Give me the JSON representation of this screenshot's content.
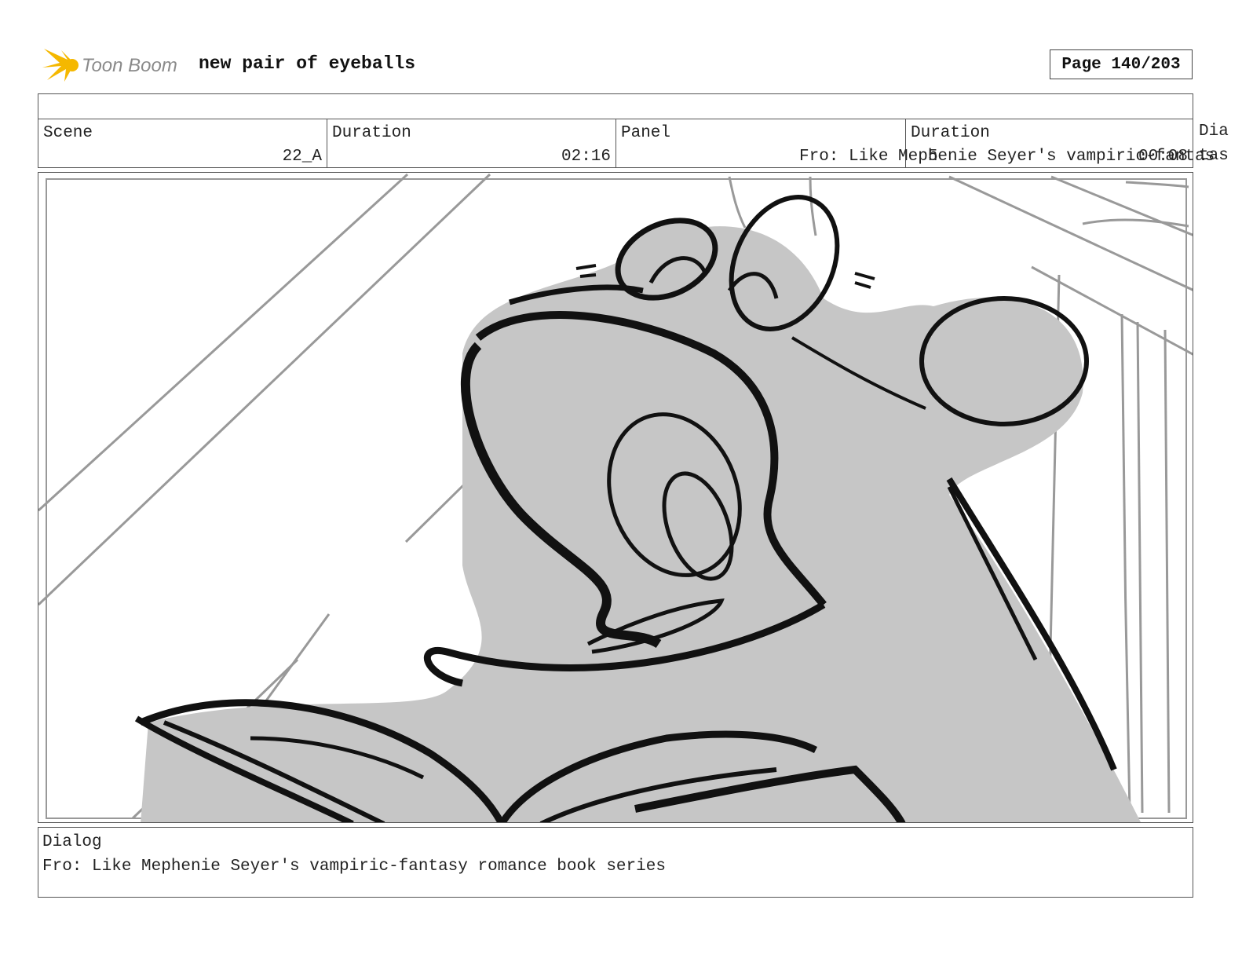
{
  "header": {
    "logo_text": "Toon Boom",
    "title": "new pair of eyeballs",
    "page": "Page 140/203"
  },
  "info": {
    "scene_label": "Scene",
    "scene_value": "22_A",
    "duration_label": "Duration",
    "duration_value": "02:16",
    "panel_label": "Panel",
    "panel_value": "5",
    "panel_duration_label": "Duration",
    "panel_duration_value": "00:08",
    "dialog_label_cut": "Dia",
    "overflow_dialog": "Fro: Like Mephenie Seyer's vampiric-fantas"
  },
  "dialog": {
    "label": "Dialog",
    "text": "Fro: Like Mephenie Seyer's vampiric-fantasy romance book series"
  },
  "colors": {
    "accent": "#f5b800",
    "logo_gray": "#8a8a8a",
    "sketch_gray": "#c6c6c6",
    "ink": "#111111",
    "line_gray": "#999999"
  }
}
